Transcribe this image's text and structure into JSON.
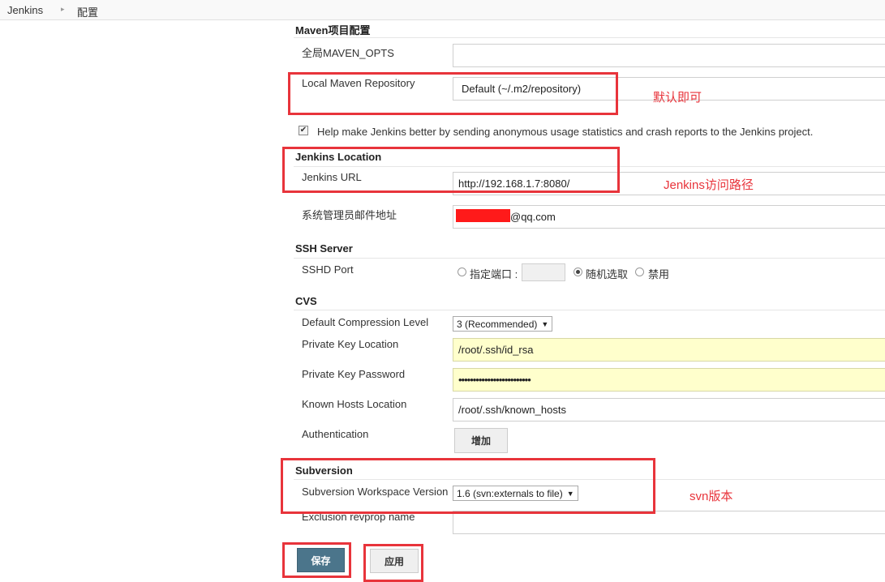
{
  "breadcrumb": {
    "root": "Jenkins",
    "current": "配置"
  },
  "maven": {
    "title": "Maven项目配置",
    "opts_label": "全局MAVEN_OPTS",
    "opts_value": "",
    "repo_label": "Local Maven Repository",
    "repo_value": "Default (~/.m2/repository)",
    "repo_annotation": "默认即可"
  },
  "usage_stats": {
    "checked": true,
    "label": "Help make Jenkins better by sending anonymous usage statistics and crash reports to the Jenkins project."
  },
  "location": {
    "title": "Jenkins Location",
    "url_label": "Jenkins URL",
    "url_value": "http://192.168.1.7:8080/",
    "url_annotation": "Jenkins访问路径",
    "email_label": "系统管理员邮件地址",
    "email_suffix": "@qq.com"
  },
  "ssh": {
    "title": "SSH Server",
    "port_label": "SSHD Port",
    "options": {
      "fixed": "指定端口 :",
      "random": "随机选取",
      "disable": "禁用"
    },
    "selected": "random",
    "port_value": ""
  },
  "cvs": {
    "title": "CVS",
    "compression_label": "Default Compression Level",
    "compression_value": "3 (Recommended)",
    "private_key_location_label": "Private Key Location",
    "private_key_location_value": "/root/.ssh/id_rsa",
    "private_key_password_label": "Private Key Password",
    "private_key_password_value": "•••••••••••••••••••••••••",
    "known_hosts_label": "Known Hosts Location",
    "known_hosts_value": "/root/.ssh/known_hosts",
    "auth_label": "Authentication",
    "add_button": "增加"
  },
  "subversion": {
    "title": "Subversion",
    "workspace_version_label": "Subversion Workspace Version",
    "workspace_version_value": "1.6 (svn:externals to file)",
    "annotation": "svn版本",
    "exclusion_label": "Exclusion revprop name"
  },
  "actions": {
    "save": "保存",
    "apply": "应用"
  },
  "colors": {
    "annotation_red": "#e8343b",
    "save_button": "#4b758b",
    "highlight_input": "#ffffcc"
  }
}
